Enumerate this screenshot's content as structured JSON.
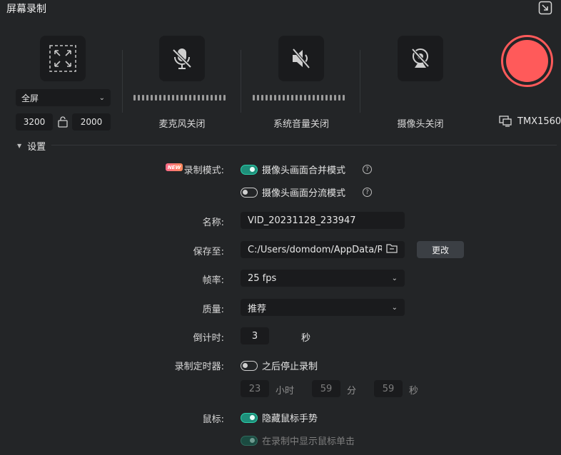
{
  "window": {
    "title": "屏幕录制"
  },
  "capture": {
    "mode_select": "全屏",
    "width": "3200",
    "height": "2000"
  },
  "sources": {
    "microphone_label": "麦克风关闭",
    "system_audio_label": "系统音量关闭",
    "camera_label": "摄像头关闭",
    "device_name": "TMX1560"
  },
  "settings": {
    "header": "设置",
    "badge_new": "NEW",
    "record_mode_label": "录制模式:",
    "mode_merge": "摄像头画面合并模式",
    "mode_split": "摄像头画面分流模式",
    "help_mark": "?",
    "name_label": "名称:",
    "name_value": "VID_20231128_233947",
    "save_label": "保存至:",
    "save_path": "C:/Users/domdom/AppData/Roa",
    "change_button": "更改",
    "fps_label": "帧率:",
    "fps_value": "25 fps",
    "quality_label": "质量:",
    "quality_value": "推荐",
    "countdown_label": "倒计时:",
    "countdown_value": "3",
    "countdown_unit": "秒",
    "timer_label": "录制定时器:",
    "timer_stop_text": "之后停止录制",
    "timer_hours": "23",
    "timer_hours_unit": "小时",
    "timer_minutes": "59",
    "timer_minutes_unit": "分",
    "timer_seconds": "59",
    "timer_seconds_unit": "秒",
    "mouse_label": "鼠标:",
    "hide_cursor": "隐藏鼠标手势",
    "show_clicks": "在录制中显示鼠标单击"
  },
  "colors": {
    "accent": "#2bd1ac",
    "record": "#ff5a5a"
  }
}
